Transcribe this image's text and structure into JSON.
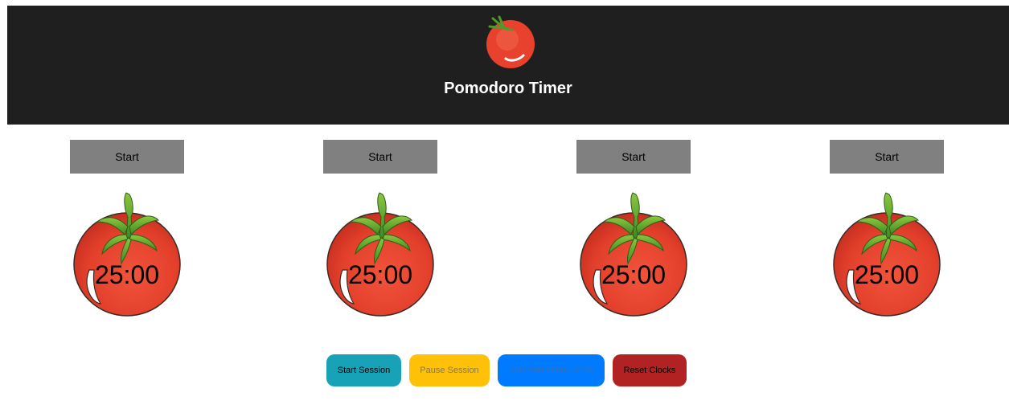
{
  "header": {
    "title": "Pomodoro Timer",
    "logo": "tomato-icon"
  },
  "clocks": [
    {
      "button_label": "Start",
      "time": "25:00"
    },
    {
      "button_label": "Start",
      "time": "25:00"
    },
    {
      "button_label": "Start",
      "time": "25:00"
    },
    {
      "button_label": "Start",
      "time": "25:00"
    }
  ],
  "controls": {
    "start_session": "Start Session",
    "pause_session": "Pause Session",
    "add_clock": "Add Pomodoro Clock",
    "reset_clocks": "Reset Clocks"
  },
  "colors": {
    "header_bg": "#1f1f1f",
    "start_session_bg": "#17a2b8",
    "pause_session_bg": "#ffc107",
    "add_clock_bg": "#007bff",
    "reset_clocks_bg": "#b22222",
    "tomato_red": "#e8412e",
    "stem_green": "#4e9a2a"
  }
}
